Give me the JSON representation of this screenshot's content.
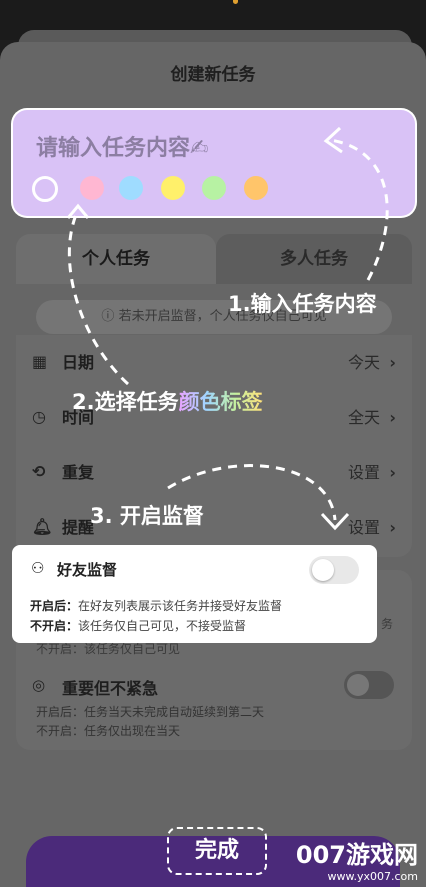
{
  "sheet": {
    "title": "创建新任务"
  },
  "task_input": {
    "placeholder": "请输入任务内容✍"
  },
  "colors": [
    "#ffb7d2",
    "#9fdcff",
    "#fff06a",
    "#b7f2a3",
    "#ffc56a"
  ],
  "tabs": [
    {
      "label": "个人任务"
    },
    {
      "label": "多人任务"
    }
  ],
  "notice": "若未开启监督，个人任务仅自己可见",
  "rows": [
    {
      "label": "日期",
      "value": "今天"
    },
    {
      "label": "时间",
      "value": "全天"
    },
    {
      "label": "重复",
      "value": "设置"
    },
    {
      "label": "提醒",
      "value": "设置"
    }
  ],
  "chevron": "›",
  "friend_supervise": {
    "title": "好友监督",
    "on_prefix": "开启后：",
    "on_text": "在好友列表展示该任务并接受好友监督",
    "off_prefix": "不开启：",
    "off_text": "该任务仅自己可见，不接受监督"
  },
  "background_ghost": {
    "line": "不开启：该任务仅自己可见",
    "side": "务"
  },
  "urgent": {
    "title": "重要但不紧急",
    "on_text": "开启后：任务当天未完成自动延续到第二天",
    "off_text": "不开启：任务仅出现在当天"
  },
  "captions": {
    "step1": "1.输入任务内容",
    "step2_prefix": "2.选择任务",
    "step2_highlight": "颜色标签",
    "step3": "3. 开启监督"
  },
  "done_label": "完成",
  "watermark": {
    "big": "007游戏网",
    "small": "www.yx007.com"
  }
}
